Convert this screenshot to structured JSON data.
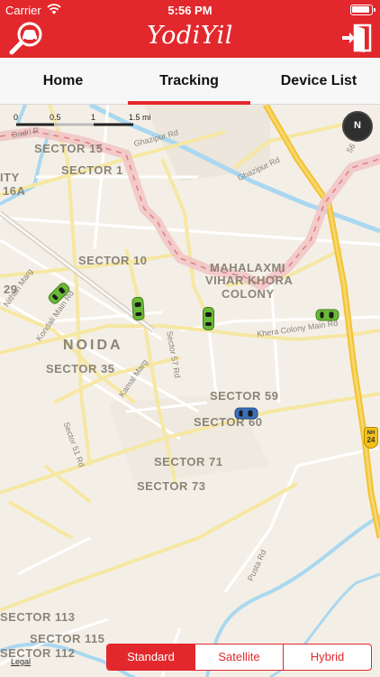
{
  "status_bar": {
    "carrier": "Carrier",
    "time": "5:56 PM"
  },
  "app": {
    "title": "YodiYil"
  },
  "tabs": [
    {
      "label": "Home",
      "active": false
    },
    {
      "label": "Tracking",
      "active": true
    },
    {
      "label": "Device List",
      "active": false
    }
  ],
  "map": {
    "scale": {
      "zero": "0",
      "half": "0.5",
      "one": "1",
      "mi": "1.5 mi"
    },
    "compass": "N",
    "areas": [
      {
        "text": "SECTOR 15"
      },
      {
        "text": "SECTOR 1"
      },
      {
        "text": "ITY"
      },
      {
        "text": "16A"
      },
      {
        "text": "SECTOR 10"
      },
      {
        "text": "29"
      },
      {
        "text": "MAHALAXMI"
      },
      {
        "text": "VIHAR KHORA"
      },
      {
        "text": "COLONY"
      },
      {
        "text": "NOIDA"
      },
      {
        "text": "SECTOR 35"
      },
      {
        "text": "SECTOR 59"
      },
      {
        "text": "SECTOR 60"
      },
      {
        "text": "SECTOR 71"
      },
      {
        "text": "SECTOR 73"
      },
      {
        "text": "SECTOR 113"
      },
      {
        "text": "SECTOR 115"
      },
      {
        "text": "SECTOR 112"
      }
    ],
    "roads": [
      {
        "text": "Dadri R"
      },
      {
        "text": "Ghazipur Rd"
      },
      {
        "text": "Ghazipur Rd"
      },
      {
        "text": "Nithari Marg"
      },
      {
        "text": "Kondali Main Rd"
      },
      {
        "text": "Kamal Marg"
      },
      {
        "text": "Sector 57 Rd"
      },
      {
        "text": "Khera Colony Main Rd"
      },
      {
        "text": "Sector 51 Rd"
      },
      {
        "text": "Pusta Rd"
      },
      {
        "text": "56"
      }
    ],
    "highway": {
      "prefix": "NH",
      "number": "24"
    },
    "legal": "Legal"
  },
  "map_type": {
    "options": [
      "Standard",
      "Satellite",
      "Hybrid"
    ],
    "selected": "Standard"
  },
  "colors": {
    "brand": "#e2282c",
    "route": "#f2c4c4",
    "vehicle_active": "#6ab937",
    "vehicle_selected": "#3b6fb8"
  },
  "icons": {
    "search_vehicle": "search-car-icon",
    "logout": "exit-door-icon"
  }
}
